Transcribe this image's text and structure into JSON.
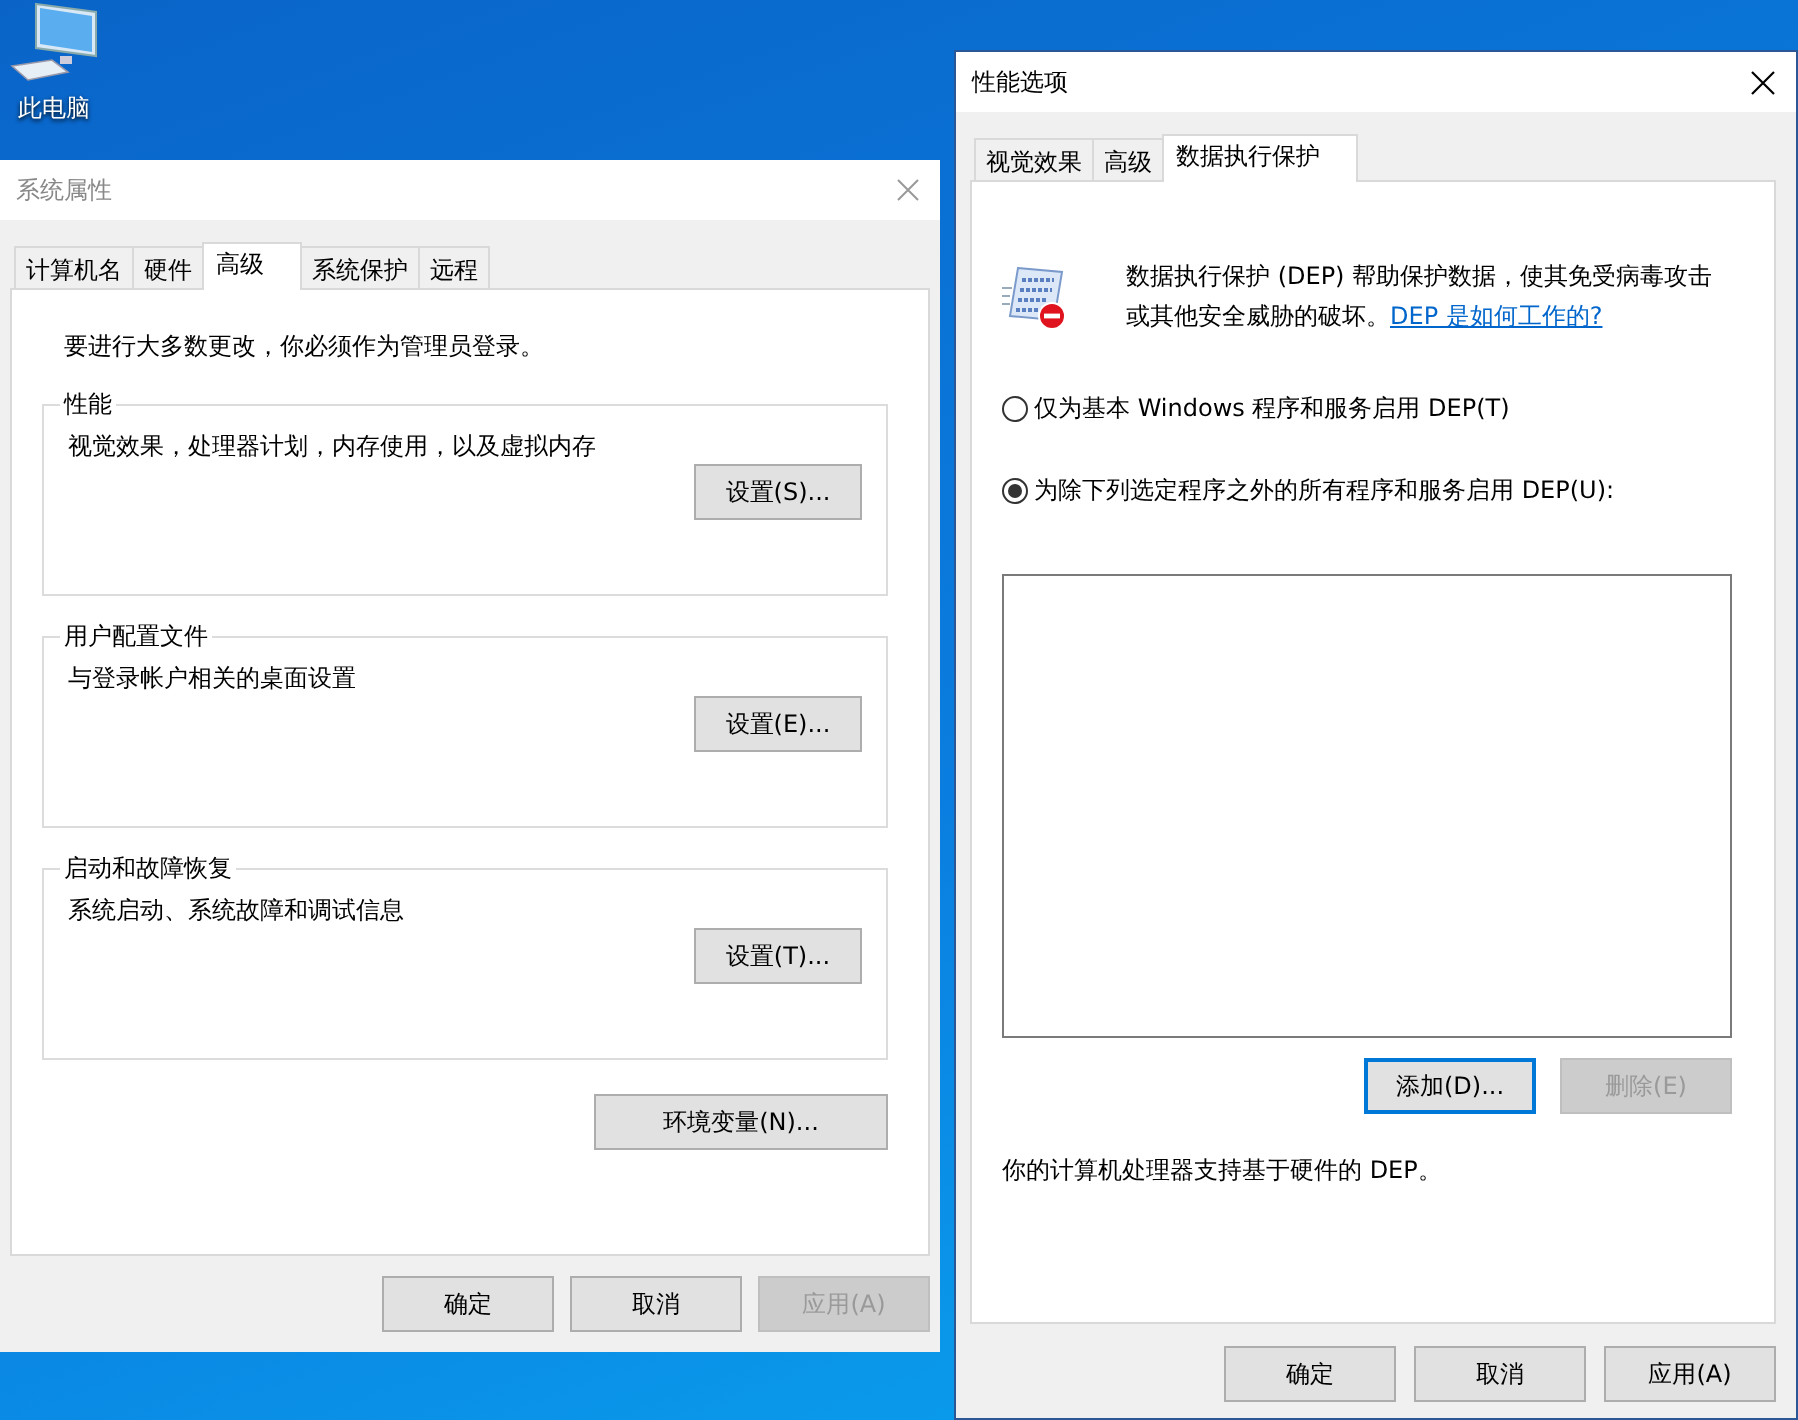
{
  "desktop_icons": [
    {
      "label": "此电脑"
    }
  ],
  "system_properties": {
    "title": "系统属性",
    "active": false,
    "tabs": [
      {
        "label": "计算机名",
        "selected": false
      },
      {
        "label": "硬件",
        "selected": false
      },
      {
        "label": "高级",
        "selected": true
      },
      {
        "label": "系统保护",
        "selected": false
      },
      {
        "label": "远程",
        "selected": false
      }
    ],
    "notice": "要进行大多数更改，你必须作为管理员登录。",
    "groups": [
      {
        "title": "性能",
        "description": "视觉效果，处理器计划，内存使用，以及虚拟内存",
        "button": "设置(S)..."
      },
      {
        "title": "用户配置文件",
        "description": "与登录帐户相关的桌面设置",
        "button": "设置(E)..."
      },
      {
        "title": "启动和故障恢复",
        "description": "系统启动、系统故障和调试信息",
        "button": "设置(T)..."
      }
    ],
    "env_button": "环境变量(N)...",
    "buttons": [
      {
        "label": "确定",
        "disabled": false
      },
      {
        "label": "取消",
        "disabled": false
      },
      {
        "label": "应用(A)",
        "disabled": true
      }
    ]
  },
  "performance_options": {
    "title": "性能选项",
    "active": true,
    "tabs": [
      {
        "label": "视觉效果",
        "selected": false
      },
      {
        "label": "高级",
        "selected": false
      },
      {
        "label": "数据执行保护",
        "selected": true
      }
    ],
    "intro": {
      "text": "数据执行保护 (DEP) 帮助保护数据，使其免受病毒攻击或其他安全威胁的破坏。",
      "link": "DEP 是如何工作的?"
    },
    "radios": [
      {
        "label": "仅为基本 Windows 程序和服务启用 DEP(T)",
        "selected": false
      },
      {
        "label": "为除下列选定程序之外的所有程序和服务启用 DEP(U):",
        "selected": true
      }
    ],
    "action_buttons": [
      {
        "label": "添加(D)...",
        "disabled": false,
        "focused": true
      },
      {
        "label": "删除(E)",
        "disabled": true,
        "focused": false
      }
    ],
    "hardware_note": "你的计算机处理器支持基于硬件的 DEP。",
    "buttons": [
      {
        "label": "确定",
        "disabled": false
      },
      {
        "label": "取消",
        "disabled": false
      },
      {
        "label": "应用(A)",
        "disabled": false
      }
    ]
  }
}
